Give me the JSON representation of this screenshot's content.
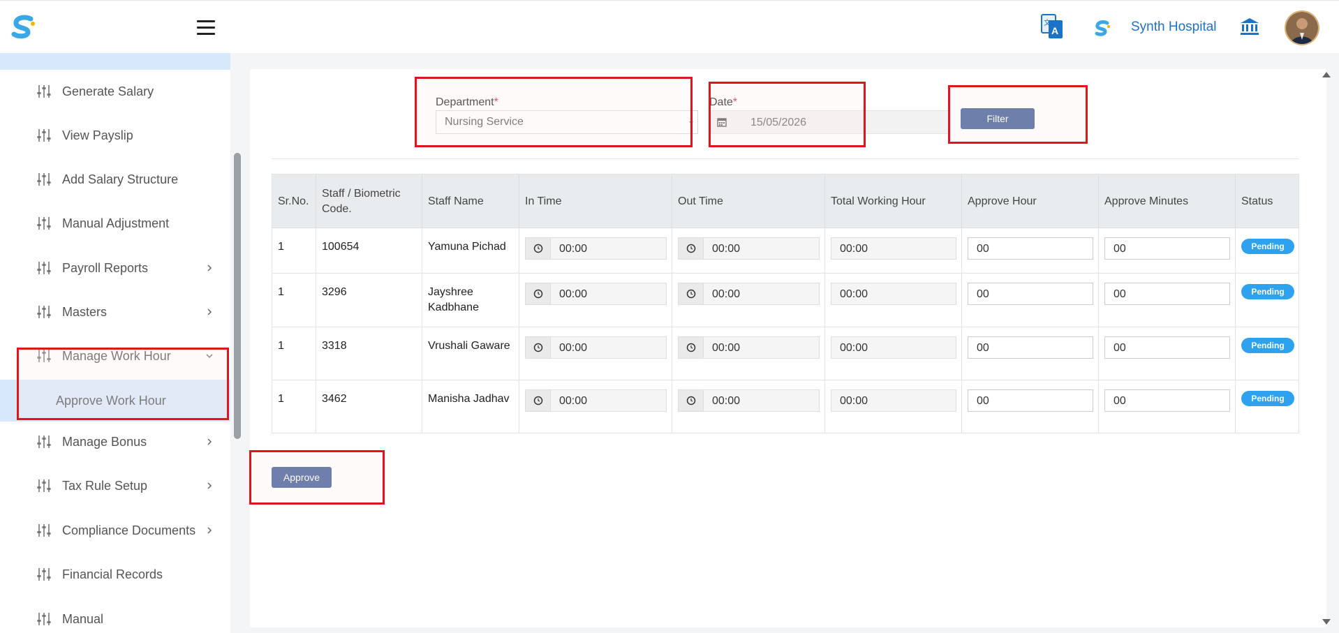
{
  "header": {
    "hospital_name": "Synth Hospital",
    "icons": [
      "app-logo-icon",
      "menu-icon",
      "translate-icon",
      "hospital-logo-icon",
      "bank-icon",
      "avatar"
    ]
  },
  "sidebar": {
    "items": [
      {
        "label": "Generate Salary",
        "has_chevron": false
      },
      {
        "label": "View Payslip",
        "has_chevron": false
      },
      {
        "label": "Add Salary Structure",
        "has_chevron": false
      },
      {
        "label": "Manual Adjustment",
        "has_chevron": false
      },
      {
        "label": "Payroll Reports",
        "has_chevron": true
      },
      {
        "label": "Masters",
        "has_chevron": true
      },
      {
        "label": "Manage Work Hour",
        "has_chevron": true,
        "expanded": true
      },
      {
        "label": "Manage Bonus",
        "has_chevron": true
      },
      {
        "label": "Tax Rule Setup",
        "has_chevron": true
      },
      {
        "label": "Compliance Documents",
        "has_chevron": true
      },
      {
        "label": "Financial Records",
        "has_chevron": false
      },
      {
        "label": "Manual",
        "has_chevron": false
      }
    ],
    "sub_item": {
      "label": "Approve Work Hour",
      "active": true
    }
  },
  "filters": {
    "department_label": "Department",
    "department_value": "Nursing Service",
    "date_label": "Date",
    "date_value": "15/05/2026",
    "required_mark": "*",
    "filter_button": "Filter"
  },
  "table": {
    "headers": [
      "Sr.No.",
      "Staff / Biometric Code.",
      "Staff Name",
      "In Time",
      "Out Time",
      "Total Working Hour",
      "Approve Hour",
      "Approve Minutes",
      "Status"
    ],
    "rows": [
      {
        "sr": "1",
        "code": "100654",
        "name": "Yamuna Pichad",
        "in_time": "00:00",
        "out_time": "00:00",
        "total": "00:00",
        "approve_hour": "00",
        "approve_minutes": "00",
        "status": "Pending"
      },
      {
        "sr": "1",
        "code": "3296",
        "name": "Jayshree Kadbhane",
        "in_time": "00:00",
        "out_time": "00:00",
        "total": "00:00",
        "approve_hour": "00",
        "approve_minutes": "00",
        "status": "Pending"
      },
      {
        "sr": "1",
        "code": "3318",
        "name": "Vrushali Gaware",
        "in_time": "00:00",
        "out_time": "00:00",
        "total": "00:00",
        "approve_hour": "00",
        "approve_minutes": "00",
        "status": "Pending"
      },
      {
        "sr": "1",
        "code": "3462",
        "name": "Manisha Jadhav",
        "in_time": "00:00",
        "out_time": "00:00",
        "total": "00:00",
        "approve_hour": "00",
        "approve_minutes": "00",
        "status": "Pending"
      }
    ]
  },
  "actions": {
    "approve_button": "Approve"
  },
  "colors": {
    "primary_button": "#3e5a96",
    "badge": "#2ea2ef",
    "annotation_red": "#e0141b",
    "accent_blue": "#1a73c9",
    "sidebar_active": "#d8e8fb"
  }
}
